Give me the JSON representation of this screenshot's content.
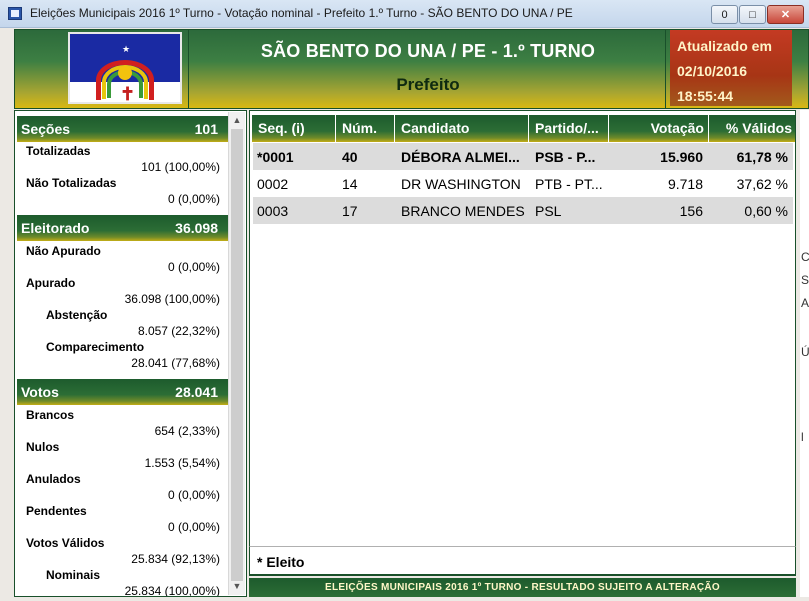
{
  "window": {
    "title": "Eleições Municipais 2016 1º Turno - Votação nominal - Prefeito 1.º Turno - SÃO BENTO DO UNA / PE",
    "min": "0",
    "max": "□",
    "close": "✕"
  },
  "header": {
    "title": "SÃO BENTO DO UNA / PE - 1.º TURNO",
    "subtitle": "Prefeito",
    "updated_label": "Atualizado em",
    "updated_date": "02/10/2016",
    "updated_time": "18:55:44"
  },
  "sections": {
    "secoes": {
      "title": "Seções",
      "total": "101",
      "totalizadas_label": "Totalizadas",
      "totalizadas_value": "101 (100,00%)",
      "nao_totalizadas_label": "Não Totalizadas",
      "nao_totalizadas_value": "0 (0,00%)"
    },
    "eleitorado": {
      "title": "Eleitorado",
      "total": "36.098",
      "nao_apurado_label": "Não Apurado",
      "nao_apurado_value": "0 (0,00%)",
      "apurado_label": "Apurado",
      "apurado_value": "36.098 (100,00%)",
      "abstencao_label": "Abstenção",
      "abstencao_value": "8.057 (22,32%)",
      "comparecimento_label": "Comparecimento",
      "comparecimento_value": "28.041 (77,68%)"
    },
    "votos": {
      "title": "Votos",
      "total": "28.041",
      "brancos_label": "Brancos",
      "brancos_value": "654 (2,33%)",
      "nulos_label": "Nulos",
      "nulos_value": "1.553 (5,54%)",
      "anulados_label": "Anulados",
      "anulados_value": "0 (0,00%)",
      "pendentes_label": "Pendentes",
      "pendentes_value": "0 (0,00%)",
      "validos_label": "Votos Válidos",
      "validos_value": "25.834 (92,13%)",
      "nominais_label": "Nominais",
      "nominais_value": "25.834 (100,00%)"
    }
  },
  "table": {
    "columns": [
      "Seq.   (i)",
      "Núm.",
      "Candidato",
      "Partido/...",
      "Votação",
      "% Válidos"
    ],
    "rows": [
      {
        "seq": "*0001",
        "num": "40",
        "candidato": "DÉBORA ALMEI...",
        "partido": "PSB - P...",
        "votacao": "15.960",
        "validos": "61,78 %"
      },
      {
        "seq": "0002",
        "num": "14",
        "candidato": "DR WASHINGTON",
        "partido": "PTB - PT...",
        "votacao": "9.718",
        "validos": "37,62 %"
      },
      {
        "seq": "0003",
        "num": "17",
        "candidato": "BRANCO MENDES",
        "partido": "PSL",
        "votacao": "156",
        "validos": "0,60 %"
      }
    ],
    "footnote": "* Eleito"
  },
  "status_bar": "ELEIÇÕES MUNICIPAIS 2016 1º TURNO - RESULTADO SUJEITO A ALTERAÇÃO",
  "scroll": {
    "up": "▲",
    "down": "▼"
  },
  "right_edge_glyphs": [
    "C",
    "S",
    "A",
    "Ú",
    "l"
  ]
}
